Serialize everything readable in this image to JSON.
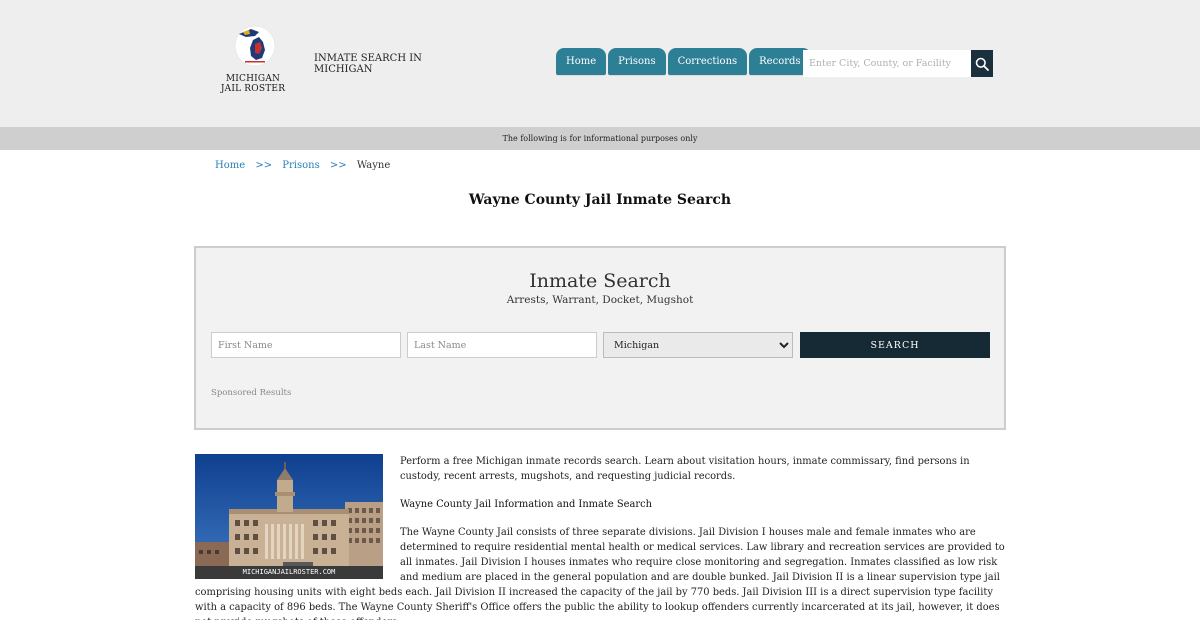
{
  "header": {
    "logo_lines": [
      "MICHIGAN",
      "JAIL ROSTER"
    ],
    "site_title": "INMATE SEARCH IN MICHIGAN",
    "nav": [
      "Home",
      "Prisons",
      "Corrections",
      "Records"
    ],
    "search_placeholder": "Enter City, County, or Facility"
  },
  "infobar": "The following is for informational purposes only",
  "breadcrumb": {
    "home": "Home",
    "sep": ">>",
    "prisons": "Prisons",
    "current": "Wayne"
  },
  "page_title": "Wayne County Jail Inmate Search",
  "search_panel": {
    "title": "Inmate Search",
    "subtitle": "Arrests, Warrant, Docket, Mugshot",
    "first_name_placeholder": "First Name",
    "last_name_placeholder": "Last Name",
    "state_selected": "Michigan",
    "button_label": "SEARCH",
    "sponsored": "Sponsored Results"
  },
  "content": {
    "photo_watermark": "MICHIGANJAILROSTER.COM",
    "intro": "Perform a free Michigan inmate records search. Learn about visitation hours, inmate commissary, find persons in custody, recent arrests, mugshots, and requesting judicial records.",
    "section_heading": "Wayne County Jail Information and Inmate Search",
    "body": "The Wayne County Jail consists of three separate divisions. Jail Division I houses male and female inmates who are determined to require residential mental health or medical services. Law library and recreation services are provided to all inmates. Jail Division I houses inmates who require close monitoring and segregation. Inmates classified as low risk and medium are placed in the general population and are double bunked. Jail Division II is a linear supervision type jail comprising housing units with eight beds each. Jail Division II increased the capacity of the jail by 770 beds. Jail Division III is a direct supervision type facility with a capacity of 896 beds. The Wayne County Sheriff's Office offers the public the ability to lookup offenders currently incarcerated at its jail, however, it does not provide mugshots of these offenders."
  },
  "colors": {
    "nav_tab": "#2d7f96",
    "search_button": "#162a36",
    "link": "#2a7fb8",
    "header_bg": "#eeeeee",
    "infobar_bg": "#cfcfcf"
  }
}
